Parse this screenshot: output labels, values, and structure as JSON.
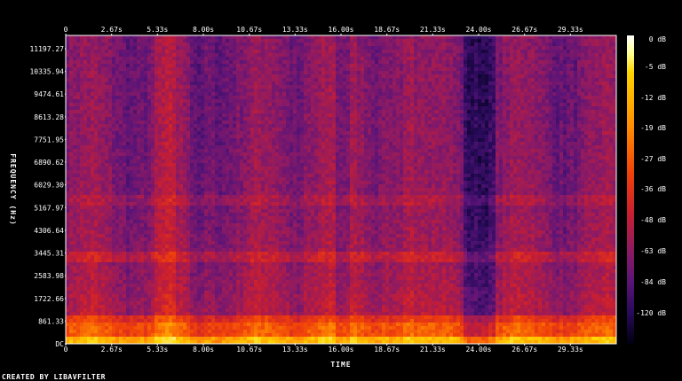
{
  "chart_data": {
    "type": "heatmap",
    "title": "",
    "xlabel": "TIME",
    "ylabel": "FREQUENCY (Hz)",
    "x_ticks": [
      "0",
      "2.67s",
      "5.33s",
      "8.00s",
      "10.67s",
      "13.33s",
      "16.00s",
      "18.67s",
      "21.33s",
      "24.00s",
      "26.67s",
      "29.33s"
    ],
    "x_tick_values": [
      0,
      2.67,
      5.33,
      8.0,
      10.67,
      13.33,
      16.0,
      18.67,
      21.33,
      24.0,
      26.67,
      29.33
    ],
    "xlim": [
      0,
      32
    ],
    "y_ticks": [
      "DC",
      "861.33",
      "1722.66",
      "2583.98",
      "3445.31",
      "4306.64",
      "5167.97",
      "6029.30",
      "6890.62",
      "7751.95",
      "8613.28",
      "9474.61",
      "10335.94",
      "11197.27"
    ],
    "y_tick_values": [
      0,
      861.33,
      1722.66,
      2583.98,
      3445.31,
      4306.64,
      5167.97,
      6029.3,
      6890.62,
      7751.95,
      8613.28,
      9474.61,
      10335.94,
      11197.27
    ],
    "ylim": [
      0,
      11700
    ],
    "colorbar": {
      "labels": [
        "0 dB",
        "-5 dB",
        "-12 dB",
        "-19 dB",
        "-27 dB",
        "-36 dB",
        "-48 dB",
        "-63 dB",
        "-84 dB",
        "-120 dB"
      ],
      "colors": [
        "#ffffff",
        "#ffff90",
        "#ffd400",
        "#ff8a00",
        "#f0400a",
        "#c81e32",
        "#8c1a64",
        "#5a1478",
        "#280a5a",
        "#000010"
      ]
    },
    "footer": "CREATED BY LIBAVFILTER"
  }
}
